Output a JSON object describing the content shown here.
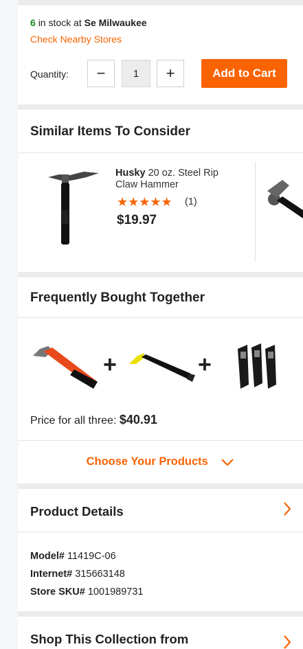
{
  "stock": {
    "count": "6",
    "text": "in stock at",
    "store": "Se Milwaukee",
    "nearby_link": "Check Nearby Stores"
  },
  "quantity": {
    "label": "Quantity:",
    "minus": "−",
    "value": "1",
    "plus": "+"
  },
  "add_to_cart": "Add to Cart",
  "similar": {
    "title": "Similar Items To Consider",
    "item": {
      "brand": "Husky",
      "name": "20 oz. Steel Rip Claw Hammer",
      "stars": "★★★★★",
      "rating_count": "(1)",
      "price": "$19.97"
    }
  },
  "fbt": {
    "title": "Frequently Bought Together",
    "plus1": "+",
    "plus2": "+",
    "price_label": "Price for all three:",
    "price_value": "$40.91",
    "choose": "Choose Your Products"
  },
  "details": {
    "title": "Product Details",
    "model_label": "Model#",
    "model_value": "11419C-06",
    "internet_label": "Internet#",
    "internet_value": "315663148",
    "sku_label": "Store SKU#",
    "sku_value": "1001989731"
  },
  "shop": {
    "title": "Shop This Collection from"
  },
  "colors": {
    "accent": "#f96302",
    "stock_green": "#1a8a1a"
  },
  "icons": [
    "chevron-down-icon",
    "chevron-right-icon",
    "hammer-image",
    "pry-bar-image",
    "utility-knives-image"
  ]
}
